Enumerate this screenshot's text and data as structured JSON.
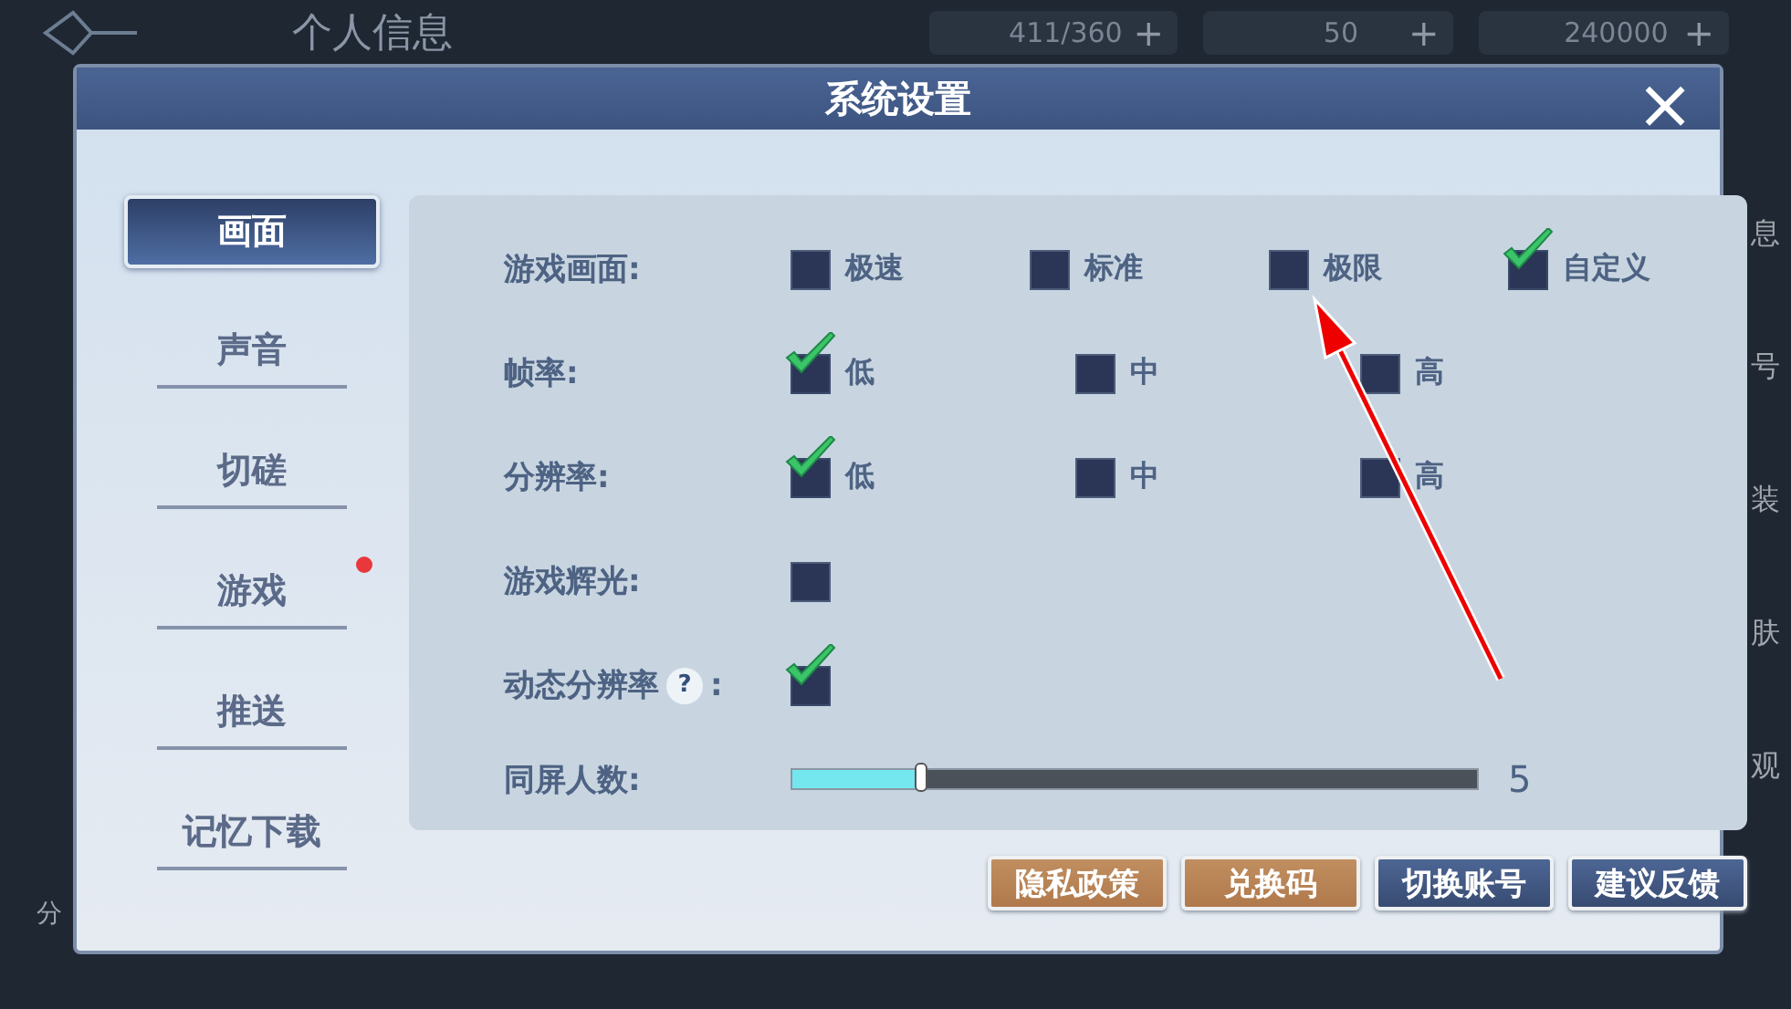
{
  "background": {
    "title": "个人信息",
    "resources": [
      {
        "amount": "411/360",
        "add": "+"
      },
      {
        "amount": "50",
        "add": "+"
      },
      {
        "amount": "240000",
        "add": "+"
      }
    ],
    "side_labels": [
      "息",
      "号",
      "装",
      "肤",
      "观"
    ],
    "corner_label": "分"
  },
  "dialog": {
    "title": "系统设置",
    "close": "×"
  },
  "sidebar": {
    "items": [
      {
        "label": "画面",
        "selected": true,
        "badge": false
      },
      {
        "label": "声音",
        "selected": false,
        "badge": false
      },
      {
        "label": "切磋",
        "selected": false,
        "badge": false
      },
      {
        "label": "游戏",
        "selected": false,
        "badge": true
      },
      {
        "label": "推送",
        "selected": false,
        "badge": false
      },
      {
        "label": "记忆下载",
        "selected": false,
        "badge": false
      }
    ]
  },
  "settings": [
    {
      "kind": "options",
      "label": "游戏画面:",
      "options": [
        {
          "label": "极速",
          "checked": false
        },
        {
          "label": "标准",
          "checked": false
        },
        {
          "label": "极限",
          "checked": false
        },
        {
          "label": "自定义",
          "checked": true
        }
      ]
    },
    {
      "kind": "options",
      "label": "帧率:",
      "options": [
        {
          "label": "低",
          "checked": true
        },
        {
          "label": "中",
          "checked": false
        },
        {
          "label": "高",
          "checked": false
        }
      ]
    },
    {
      "kind": "options",
      "label": "分辨率:",
      "options": [
        {
          "label": "低",
          "checked": true
        },
        {
          "label": "中",
          "checked": false
        },
        {
          "label": "高",
          "checked": false
        }
      ]
    },
    {
      "kind": "toggle",
      "label": "游戏辉光:",
      "checked": false
    },
    {
      "kind": "toggle",
      "label": "动态分辨率",
      "help": "?",
      "suffix": ":",
      "checked": true
    },
    {
      "kind": "slider",
      "label": "同屏人数:",
      "level": 0.19,
      "value": "5"
    }
  ],
  "buttons": [
    {
      "label": "隐私政策",
      "kind": "gold"
    },
    {
      "label": "兑换码",
      "kind": "gold"
    },
    {
      "label": "切换账号",
      "kind": "blue"
    },
    {
      "label": "建议反馈",
      "kind": "blue"
    }
  ]
}
